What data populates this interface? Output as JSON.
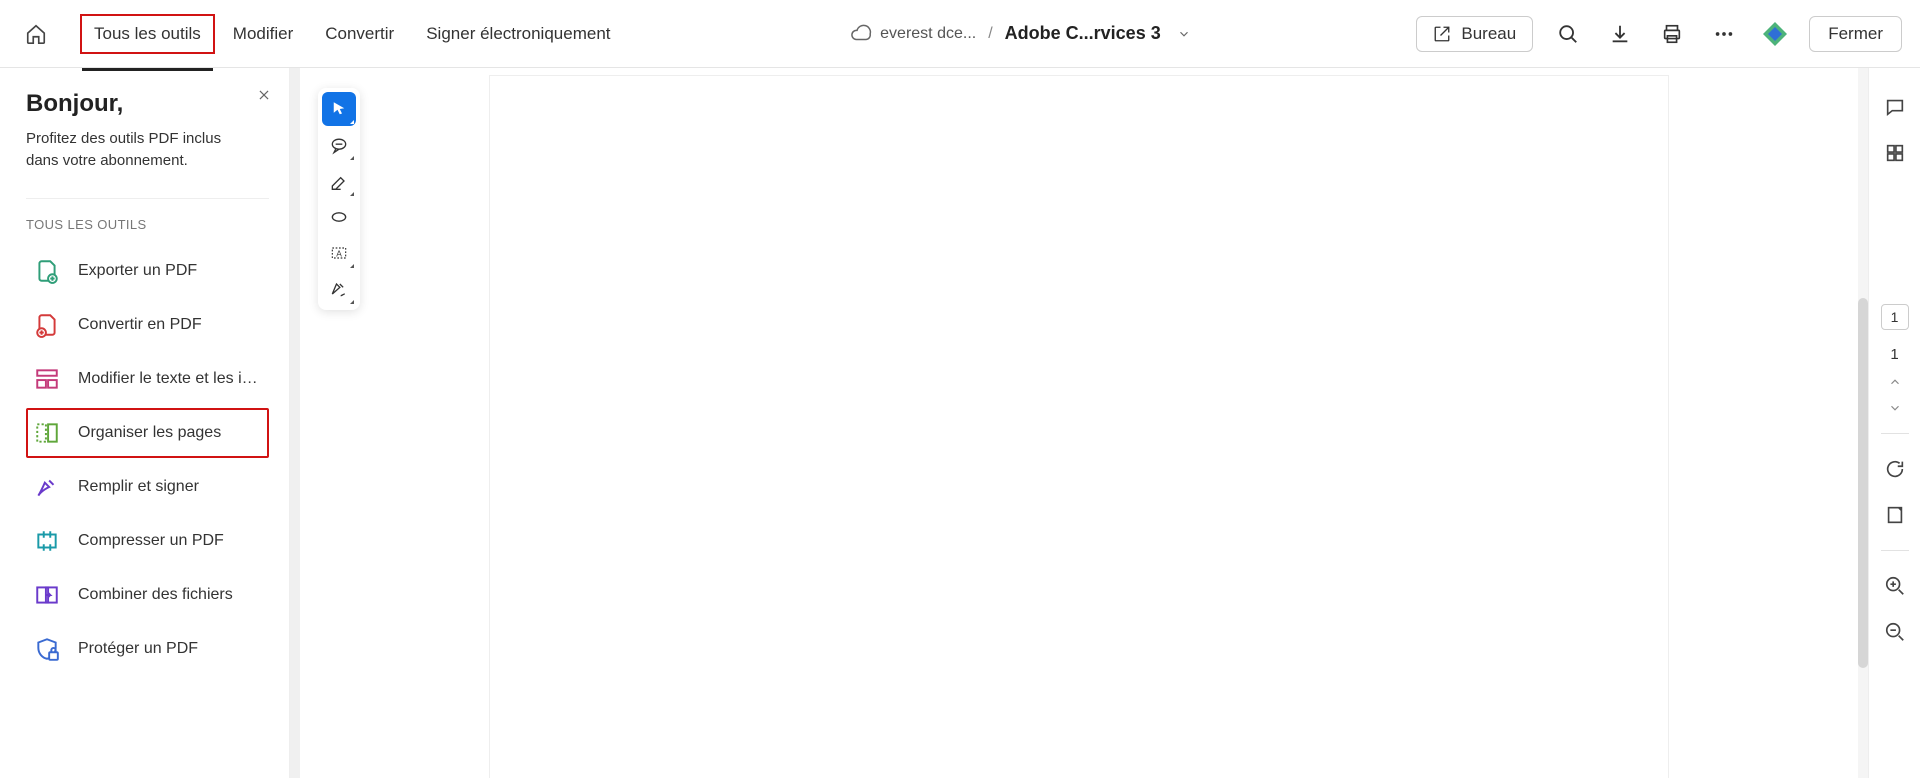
{
  "topbar": {
    "tabs": {
      "all_tools": "Tous les outils",
      "edit": "Modifier",
      "convert": "Convertir",
      "sign": "Signer électroniquement"
    },
    "cloud_label": "everest dce...",
    "file_separator": "/",
    "file_name": "Adobe C...rvices 3",
    "bureau_label": "Bureau",
    "close_label": "Fermer"
  },
  "sidebar": {
    "greeting": "Bonjour,",
    "subtitle": "Profitez des outils PDF inclus dans votre abonnement.",
    "section_title": "TOUS LES OUTILS",
    "tools": [
      {
        "label": "Exporter un PDF"
      },
      {
        "label": "Convertir en PDF"
      },
      {
        "label": "Modifier le texte et les im..."
      },
      {
        "label": "Organiser les pages"
      },
      {
        "label": "Remplir et signer"
      },
      {
        "label": "Compresser un PDF"
      },
      {
        "label": "Combiner des fichiers"
      },
      {
        "label": "Protéger un PDF"
      }
    ]
  },
  "right_rail": {
    "page_current": "1",
    "page_total": "1"
  }
}
